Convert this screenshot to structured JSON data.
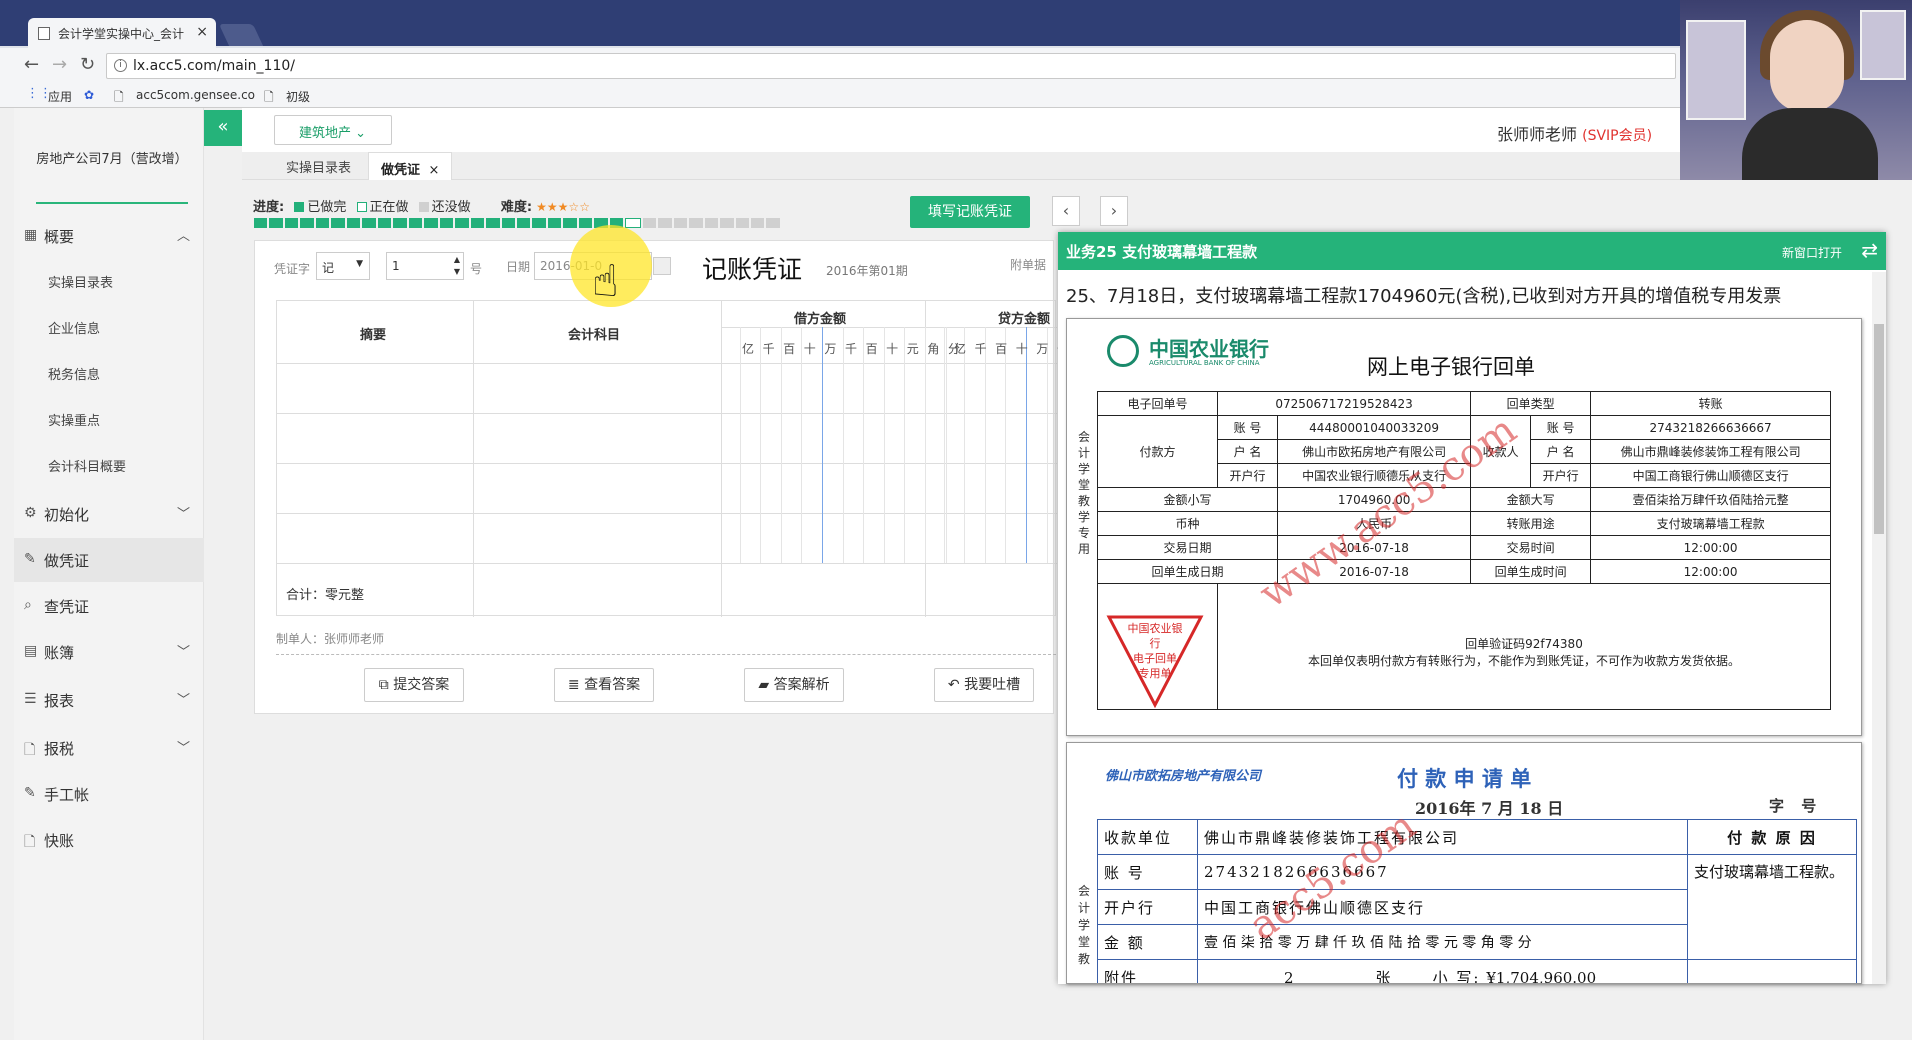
{
  "browser": {
    "tab_title": "会计学堂实操中心_会计",
    "tab_close": "×",
    "url": "lx.acc5.com/main_110/",
    "bookmarks": [
      "应用",
      "acc5com.gensee.co",
      "初级"
    ]
  },
  "sidebar": {
    "company": "房地产公司7月（营改增）",
    "items": [
      {
        "label": "概要",
        "icon": "grid-icon",
        "chevron": "up"
      },
      {
        "label": "实操目录表"
      },
      {
        "label": "企业信息"
      },
      {
        "label": "税务信息"
      },
      {
        "label": "实操重点"
      },
      {
        "label": "会计科目概要"
      },
      {
        "label": "初始化",
        "icon": "gear-icon",
        "chevron": "down"
      },
      {
        "label": "做凭证",
        "icon": "pen-icon"
      },
      {
        "label": "查凭证",
        "icon": "search-icon"
      },
      {
        "label": "账簿",
        "icon": "book-icon",
        "chevron": "down"
      },
      {
        "label": "报表",
        "icon": "list-icon",
        "chevron": "down"
      },
      {
        "label": "报税",
        "icon": "file-icon",
        "chevron": "down"
      },
      {
        "label": "手工帐",
        "icon": "pen-icon"
      },
      {
        "label": "快账",
        "icon": "file-icon"
      }
    ]
  },
  "header": {
    "collapse_icon": "«",
    "project": "建筑地产",
    "teacher": "张师师老师",
    "badge": "(SVIP会员)"
  },
  "tabs": [
    {
      "label": "实操目录表"
    },
    {
      "label": "做凭证",
      "close": "×"
    }
  ],
  "progress": {
    "label": "进度:",
    "done": "已做完",
    "doing": "正在做",
    "todo": "还没做",
    "difficulty_label": "难度:",
    "difficulty_stars": 3,
    "total": 34,
    "completed": 24,
    "current": 25
  },
  "fill_button": "填写记账凭证",
  "voucher": {
    "word_label": "凭证字",
    "word_value": "记",
    "number_value": "1",
    "number_suffix": "号",
    "date_label": "日期",
    "date_value": "2016-01-0",
    "title": "记账凭证",
    "period": "2016年第01期",
    "attach_label": "附单据",
    "col_summary": "摘要",
    "col_account": "会计科目",
    "col_debit": "借方金额",
    "col_credit": "贷方金额",
    "debit_units": [
      "亿",
      "千",
      "百",
      "十",
      "万",
      "千",
      "百",
      "十",
      "元",
      "角",
      "分"
    ],
    "credit_units": [
      "亿",
      "千",
      "百",
      "十",
      "万",
      "千",
      "百"
    ],
    "total": "合计：零元整",
    "maker": "制单人：张师师老师",
    "buttons": [
      "提交答案",
      "查看答案",
      "答案解析",
      "我要吐槽"
    ]
  },
  "business": {
    "title": "业务25 支付玻璃幕墙工程款",
    "new_window": "新窗口打开",
    "description": "25、7月18日，支付玻璃幕墙工程款1704960元(含税),已收到对方开具的增值税专用发票"
  },
  "bank_receipt": {
    "bank_name": "中国农业银行",
    "bank_name_en": "AGRICULTURAL BANK OF CHINA",
    "title": "网上电子银行回单",
    "side_text": "会计学堂教学专用",
    "rows": [
      [
        "电子回单号",
        "072506717219528423",
        "回单类型",
        "转账"
      ],
      [
        "付款方",
        "账 号",
        "444800010400332​09",
        "收款人",
        "账 号",
        "274321826663​6667"
      ],
      [
        "户 名",
        "佛山市欧拓房地产有限公司",
        "户 名",
        "佛山市鼎峰装修装饰工程有限公司"
      ],
      [
        "开户行",
        "中国农业银行顺德乐从支行",
        "开户行",
        "中国工商银行佛山顺德区支行"
      ],
      [
        "金额小写",
        "1704960.00",
        "金额大写",
        "壹佰柒拾万肆仟玖佰陆拾元整"
      ],
      [
        "币种",
        "人民币",
        "转账用途",
        "支付玻璃幕墙工程款"
      ],
      [
        "交易日期",
        "2016-07-18",
        "交易时间",
        "12:00:00"
      ],
      [
        "回单生成日期",
        "2016-07-18",
        "回单生成时间",
        "12:00:00"
      ]
    ],
    "stamp": [
      "中国农业银行",
      "电子回单",
      "专用单"
    ],
    "verify": "回单验证码92f74380",
    "note": "本回单仅表明付款方有转账行为，不能作为到账凭证，不可作为收款方发货依据。",
    "watermark": "www.acc5.com"
  },
  "payment": {
    "company": "佛山市欧拓房地产有限公司",
    "title": "付 款 申 请 单",
    "date": "2016年 7 月 18 日",
    "no_label": "字 号",
    "side_text": "会计学堂教",
    "rows": [
      [
        "收款单位",
        "佛山市鼎峰装修装饰工程有限公司"
      ],
      [
        "账 号",
        "2743218266636667"
      ],
      [
        "开户行",
        "中国工商银行佛山顺德区支行"
      ],
      [
        "金 额",
        "壹 佰 柒 拾 零 万 肆 仟 玖 佰 陆 拾 零 元 零 角 零 分"
      ]
    ],
    "reason_label": "付 款 原 因",
    "reason": "支付玻璃幕墙工程款。",
    "attach_label": "附件",
    "attach_value": "2",
    "attach_unit": "张",
    "small_label": "小 写:",
    "small_value": "¥1,704,960.00",
    "watermark": "acc5.com"
  },
  "colors": {
    "accent": "#25b37a",
    "brand_dark": "#2f3e74",
    "vip": "#e0332f",
    "stamp": "#d62828"
  }
}
